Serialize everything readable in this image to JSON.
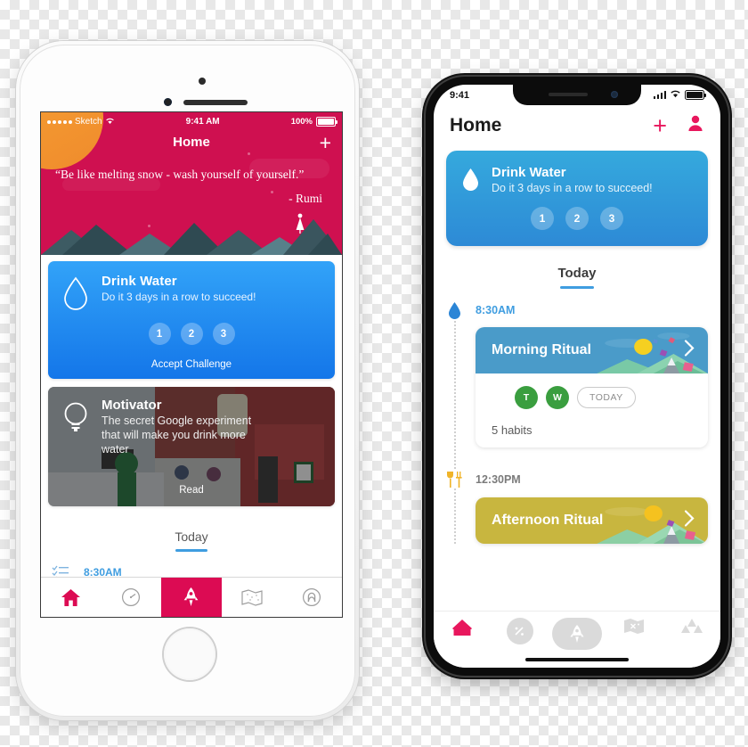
{
  "left_phone": {
    "device": "iphone-8-white",
    "status_bar": {
      "carrier": "Sketch",
      "time": "9:41 AM",
      "battery": "100%",
      "signal_dots": 5,
      "wifi_icon": "wifi-icon"
    },
    "nav": {
      "title": "Home",
      "add_label": "+",
      "add_icon": "plus-icon"
    },
    "hero": {
      "quote": "“Be like melting snow - wash yourself of yourself.”",
      "author": "- Rumi",
      "bg_color": "#cf1050",
      "sun_color": "#f2912e",
      "mountain_colors": [
        "#2f4a52",
        "#3d5b63",
        "#4a6b74",
        "#58808a"
      ]
    },
    "water_card": {
      "icon": "water-drop-icon",
      "title": "Drink Water",
      "subtitle": "Do it 3 days in a row to succeed!",
      "days": [
        "1",
        "2",
        "3"
      ],
      "cta": "Accept Challenge",
      "gradient_from": "#32a3f8",
      "gradient_to": "#1476e9"
    },
    "motivator_card": {
      "icon": "lightbulb-icon",
      "title": "Motivator",
      "subtitle": "The secret Google experiment that will make you drink more water",
      "cta": "Read"
    },
    "today": {
      "label": "Today",
      "underline_color": "#3f9de0"
    },
    "timeline": [
      {
        "icon": "checklist-icon",
        "time": "8:30AM"
      }
    ],
    "tabbar": [
      {
        "name": "home",
        "icon": "home-icon",
        "active": true,
        "color": "#dc0b53"
      },
      {
        "name": "progress",
        "icon": "speedometer-icon",
        "active": false
      },
      {
        "name": "challenges",
        "icon": "rocket-icon",
        "active": true,
        "highlight": true
      },
      {
        "name": "map",
        "icon": "map-icon",
        "active": false
      },
      {
        "name": "profile",
        "icon": "profile-icon",
        "active": false
      }
    ]
  },
  "right_phone": {
    "device": "iphone-x-black",
    "status_bar": {
      "time": "9:41",
      "signal_icon": "cellular-bars-icon",
      "wifi_icon": "wifi-icon",
      "battery_icon": "battery-icon"
    },
    "header": {
      "title": "Home",
      "add_icon": "plus-icon",
      "account_icon": "person-icon",
      "accent": "#e8175d"
    },
    "water_card": {
      "icon": "water-drop-icon",
      "title": "Drink Water",
      "subtitle": "Do it 3 days in a row to succeed!",
      "days": [
        "1",
        "2",
        "3"
      ],
      "gradient_from": "#35a9dd",
      "gradient_to": "#2d8ad6"
    },
    "today": {
      "label": "Today",
      "underline_color": "#3f9de0"
    },
    "timeline": [
      {
        "icon": "water-drop-icon",
        "time": "8:30AM",
        "time_color": "#3f9de0",
        "ritual": {
          "title": "Morning Ritual",
          "banner_color": "#4a9bc9",
          "chevron": "chevron-right-icon",
          "habits": [
            {
              "label": "T",
              "state": "done"
            },
            {
              "label": "W",
              "state": "done"
            }
          ],
          "today_pill": "TODAY",
          "count": "5 habits"
        }
      },
      {
        "icon": "cutlery-icon",
        "time": "12:30PM",
        "time_color": "#7b7b7b",
        "ritual": {
          "title": "Afternoon Ritual",
          "banner_color": "#c8b63f",
          "chevron": "chevron-right-icon"
        }
      }
    ],
    "tabbar": [
      {
        "name": "home",
        "icon": "home-icon",
        "active": true,
        "color": "#e8175d"
      },
      {
        "name": "progress",
        "icon": "speedometer-icon",
        "active": false
      },
      {
        "name": "challenges",
        "icon": "rocket-icon",
        "active": true,
        "highlight": true
      },
      {
        "name": "map",
        "icon": "map-icon",
        "active": false
      },
      {
        "name": "groups",
        "icon": "triangles-icon",
        "active": false
      }
    ]
  }
}
